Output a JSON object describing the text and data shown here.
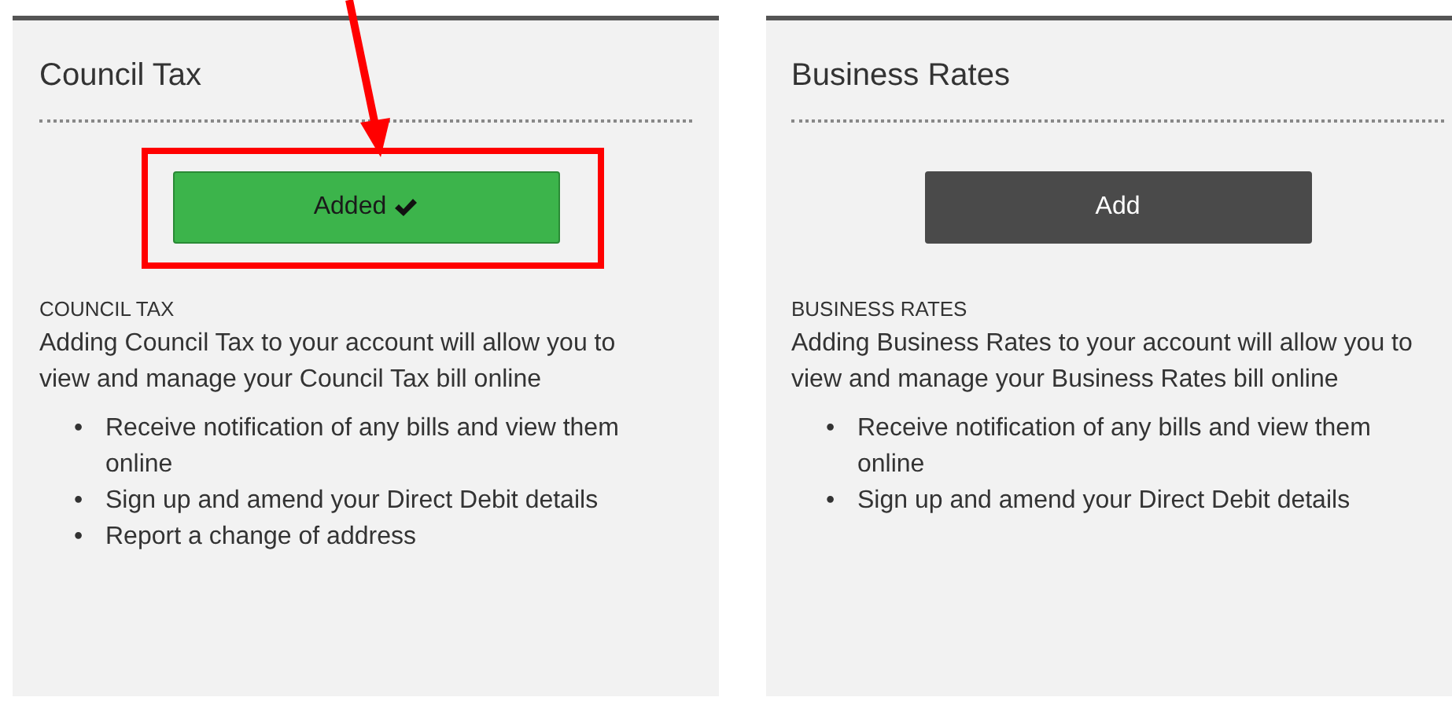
{
  "cards": [
    {
      "title": "Council Tax",
      "button": {
        "label": "Added",
        "added": true
      },
      "highlighted": true,
      "heading": "COUNCIL TAX",
      "bullet": "•",
      "description": "Adding Council Tax to your account will allow you to view and manage your Council Tax bill online",
      "features": [
        "Receive notification of any bills and view them online",
        "Sign up and amend your Direct Debit details",
        "Report a change of address"
      ]
    },
    {
      "title": "Business Rates",
      "button": {
        "label": "Add",
        "added": false
      },
      "highlighted": false,
      "heading": "BUSINESS RATES",
      "bullet": "•",
      "description": "Adding Business Rates to your account will allow you to view and manage your Business Rates bill online",
      "features": [
        "Receive notification of any bills and view them online",
        "Sign up and amend your Direct Debit details"
      ]
    }
  ]
}
